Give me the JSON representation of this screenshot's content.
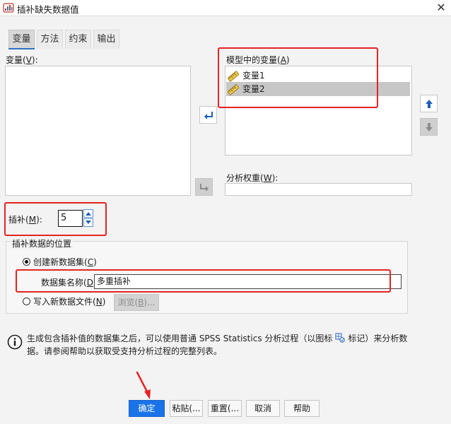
{
  "window": {
    "title": "插补缺失数据值",
    "close_glyph": "✕",
    "icon": "spss-app-icon"
  },
  "tabs": [
    {
      "label": "变量",
      "active": true
    },
    {
      "label": "方法",
      "active": false
    },
    {
      "label": "约束",
      "active": false
    },
    {
      "label": "输出",
      "active": false
    }
  ],
  "variables": {
    "label": "变量",
    "mnemonic": "V",
    "items": []
  },
  "model_vars": {
    "label": "模型中的变量",
    "mnemonic": "A",
    "items": [
      {
        "name": "变量1",
        "selected": false
      },
      {
        "name": "变量2",
        "selected": true
      }
    ]
  },
  "analysis_weight": {
    "label": "分析权重",
    "mnemonic": "W",
    "value": ""
  },
  "imputations": {
    "label": "插补",
    "mnemonic": "M",
    "value": "5"
  },
  "location": {
    "group_label": "插补数据的位置",
    "create_option": {
      "label": "创建新数据集",
      "mnemonic": "C",
      "selected": true
    },
    "dataset_name_label": "数据集名称",
    "dataset_name_mnemonic": "D",
    "dataset_name_value": "多重插补",
    "write_option": {
      "label": "写入新数据文件",
      "mnemonic": "N",
      "selected": false
    },
    "browse_label": "浏览",
    "browse_mnemonic": "B"
  },
  "info": {
    "text_before": "生成包含插补值的数据集之后，可以使用普通 SPSS Statistics 分析过程（以图标",
    "text_after": "标记）来分析数据。请参阅帮助以获取受支持分析过程的完整列表。"
  },
  "buttons": {
    "ok": "确定",
    "paste": "粘贴(...",
    "reset": "重置(...",
    "cancel": "取消",
    "help": "帮助"
  },
  "colors": {
    "accent": "#1a73e8",
    "highlight": "#e52323",
    "selection": "#c7c7c7"
  }
}
